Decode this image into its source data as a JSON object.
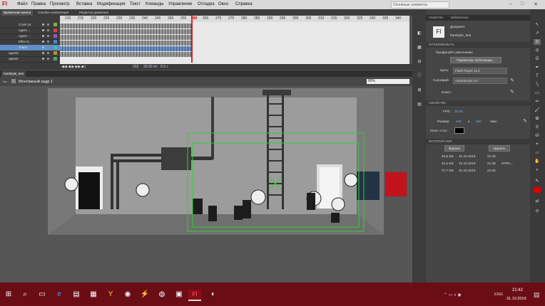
{
  "app": {
    "logo": "Fl"
  },
  "menu": [
    "Файл",
    "Правка",
    "Просмотр",
    "Вставка",
    "Модификация",
    "Текст",
    "Команды",
    "Управление",
    "Отладка",
    "Окно",
    "Справка"
  ],
  "workspace": {
    "label": "Основные элементы"
  },
  "timeline": {
    "tabs": [
      "Временная шкала",
      "Ошибки компиляции",
      "Редактор движения"
    ],
    "layers": [
      {
        "name": "Слой 16",
        "color": "#7fb04f"
      },
      {
        "name": "Agent ...",
        "color": "#d24242"
      },
      {
        "name": "Agent ...",
        "color": "#9a59c7"
      },
      {
        "name": "Elbis st...",
        "color": "#4a84d0"
      },
      {
        "name": "shape",
        "color": "#3fb6c8"
      },
      {
        "name": "agent3",
        "color": "#c58a2e"
      },
      {
        "name": "agent2",
        "color": "#4fa36b"
      }
    ],
    "ruler": [
      "210",
      "215",
      "220",
      "225",
      "230",
      "235",
      "240",
      "245",
      "250",
      "255",
      "260",
      "265",
      "270",
      "275",
      "280",
      "285",
      "290",
      "295",
      "300",
      "305",
      "310",
      "315",
      "320",
      "325",
      "330",
      "335",
      "340"
    ],
    "controls": {
      "frame": "255",
      "fps": "30,00 к/с",
      "time": "8,5 с"
    }
  },
  "document": {
    "tab": "hardstyle_test",
    "scene": "Монтажный кадр 1",
    "zoom": "80%"
  },
  "properties": {
    "tabs": [
      "Свойства",
      "Библиотека"
    ],
    "doc_label": "Документ",
    "doc_name": "hardstyle_test",
    "section_publish": "ОПУБЛИКОВАТЬ",
    "profile_label": "Профиль:",
    "profile_value": "По умолчанию",
    "publish_settings": "Параметры публикации...",
    "target_label": "Цель:",
    "target_value": "Flash Player 11.2",
    "script_label": "Сценарий:",
    "script_value": "ActionScript 3.0",
    "class_label": "Класс:",
    "section_props": "СВОЙСТВА",
    "fps_label": "FPS:",
    "fps_value": "30,00",
    "size_label": "Размер:",
    "width": "640",
    "x": "x",
    "height": "360",
    "units": "пикс.",
    "stage_label": "Монт. стол:",
    "stage_color": "#000000",
    "section_swf": "ИСТОРИЯ SWF",
    "log_button": "Журнал",
    "clear_button": "Удалить",
    "history": [
      {
        "size": "40,6 KB",
        "date": "31.10.2019",
        "time": "21:29",
        "note": ""
      },
      {
        "size": "40,2 KB",
        "date": "31.10.2019",
        "time": "21:28",
        "note": "OTPA..."
      },
      {
        "size": "37,7 KB",
        "date": "31.10.2019",
        "time": "21:26",
        "note": ""
      }
    ]
  },
  "taskbar": {
    "lang": "ENG",
    "time": "21:42",
    "date": "31.10.2019"
  }
}
